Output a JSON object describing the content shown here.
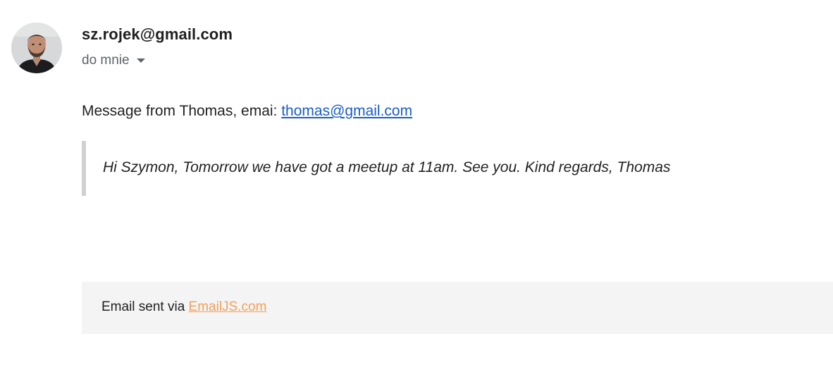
{
  "sender": {
    "email": "sz.rojek@gmail.com"
  },
  "recipient": {
    "label": "do mnie",
    "icon": "chevron-down-icon"
  },
  "message": {
    "intro_text": "Message from Thomas, emai: ",
    "contact_email": "thomas@gmail.com",
    "quote": "Hi Szymon, Tomorrow we have got a meetup at 11am. See you. Kind regards, Thomas"
  },
  "footer": {
    "text": "Email sent via ",
    "link_label": "EmailJS.com"
  },
  "colors": {
    "link": "#1a5dc8",
    "footer_link": "#f4a05a",
    "footer_bg": "#f4f4f4",
    "quote_border": "#d0d0d0"
  }
}
